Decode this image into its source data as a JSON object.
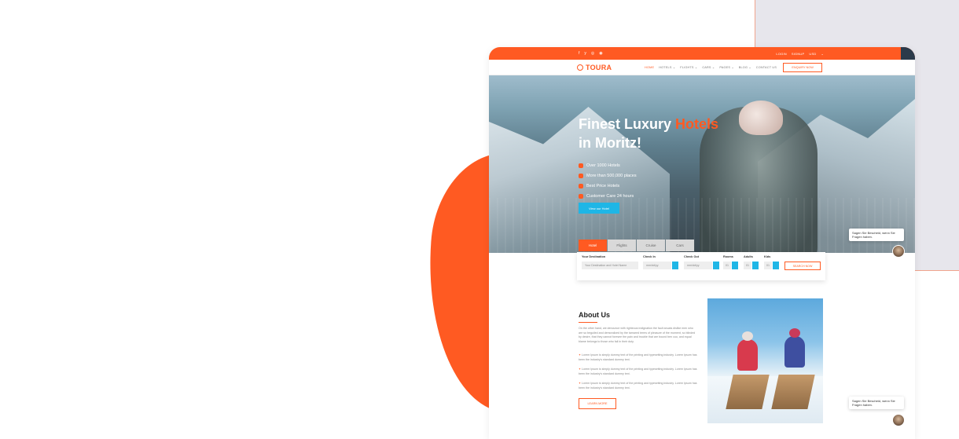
{
  "topbar": {
    "social": [
      "f",
      "y",
      "◎",
      "◉"
    ],
    "links": [
      "LOGIN",
      "SIGNUP",
      "USD",
      "⌄"
    ]
  },
  "nav": {
    "logo": "TOURA",
    "menu": [
      "HOME",
      "HOTELS ⌄",
      "FLIGHTS ⌄",
      "CARS ⌄",
      "PAGES ⌄",
      "BLOG ⌄",
      "CONTACT US"
    ],
    "enquiry": "ENQUIRY NOW"
  },
  "hero": {
    "title_part1": "Finest Luxury ",
    "title_highlight": "Hotels",
    "title_part2": "in Moritz!",
    "features": [
      "Over 1000 Hotels",
      "More than 500,000 places",
      "Best Price Hotels",
      "Customer Care 24 hours"
    ],
    "button": "View our Hotel"
  },
  "tabs": [
    "Hotel",
    "Flights",
    "Cruise",
    "Cars"
  ],
  "booking": {
    "destination_label": "Your Destination",
    "destination_placeholder": "Your Destination and Hotel Name",
    "checkin_label": "Check In",
    "checkin_placeholder": "mm/dd/yy",
    "checkout_label": "Check Out",
    "checkout_placeholder": "mm/dd/yy",
    "rooms_label": "Rooms",
    "rooms_value": "01",
    "adults_label": "Adults",
    "adults_value": "01",
    "kids_label": "Kids",
    "kids_value": "01",
    "search": "SEARCH NOW"
  },
  "chat": {
    "message": "Sagen Sie Bescheid, wenn Sie Fragen haben."
  },
  "about": {
    "title": "About Us",
    "intro": "On the other hand, we denounce with righteous indignation the fault anuals dislike men who are so beguiled and demoralized by the tamared terms of pleasure of the moment, so blinded by desire, that they cannot foresee the pain and trouble that are bound ben cuo, and equal blame belongs to those who fail in their duty.",
    "bullets": [
      "Lorem Ipsum is simply dummy text of the printing and typesetting industry. Lorem Ipsum has been the industry's standard dummy text.",
      "Lorem Ipsum is simply dummy text of the printing and typesetting industry. Lorem Ipsum has been the industry's standard dummy text.",
      "Lorem Ipsum is simply dummy text of the printing and typesetting industry. Lorem Ipsum has been the industry's standard dummy text."
    ],
    "button": "LEARN MORE"
  },
  "colors": {
    "accent": "#ff5a22",
    "cyan": "#1fb6e6"
  }
}
